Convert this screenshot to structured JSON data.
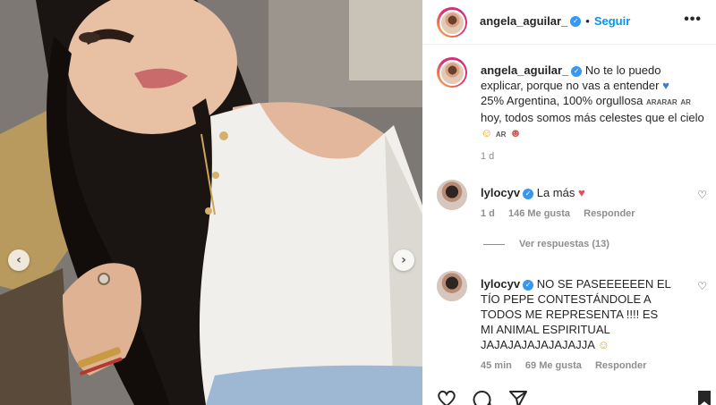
{
  "post": {
    "header": {
      "username": "angela_aguilar_",
      "separator": "•",
      "follow_label": "Seguir",
      "more_label": "•••"
    },
    "caption": {
      "username": "angela_aguilar_",
      "text_1": "No te lo puedo explicar, porque no vas a entender",
      "text_2": "25% Argentina, 100% orgullosa",
      "flags_small": "ARARAR",
      "flag_ar": "AR",
      "text_3": "hoy, todos somos más celestes que el cielo",
      "flag_ar_2": "AR",
      "time": "1 d"
    },
    "comments": [
      {
        "username": "lylocyv",
        "text": "La más",
        "time": "1 d",
        "likes": "146 Me gusta",
        "reply": "Responder"
      },
      {
        "username": "lylocyv",
        "text": "NO SE PASEEEEEEN EL TÍO PEPE CONTESTÁNDOLE A TODOS ME REPRESENTA !!!! ES MI ANIMAL ESPIRITUAL JAJAJAJAJAJAJAJJA",
        "time": "45 min",
        "likes": "69 Me gusta",
        "reply": "Responder"
      }
    ],
    "view_replies": "Ver respuestas (13)"
  },
  "icons": {
    "nav_left": "chevron-left-icon",
    "nav_right": "chevron-right-icon",
    "verified": "verified-badge-icon",
    "heart": "heart-icon",
    "comment": "comment-icon",
    "share": "share-icon",
    "bookmark": "bookmark-icon"
  },
  "colors": {
    "follow_blue": "#0095f6",
    "verified_blue": "#3897f0",
    "heart_red": "#ed4956",
    "blue_heart": "#3a7bd5",
    "meta_gray": "#8e8e8e"
  }
}
